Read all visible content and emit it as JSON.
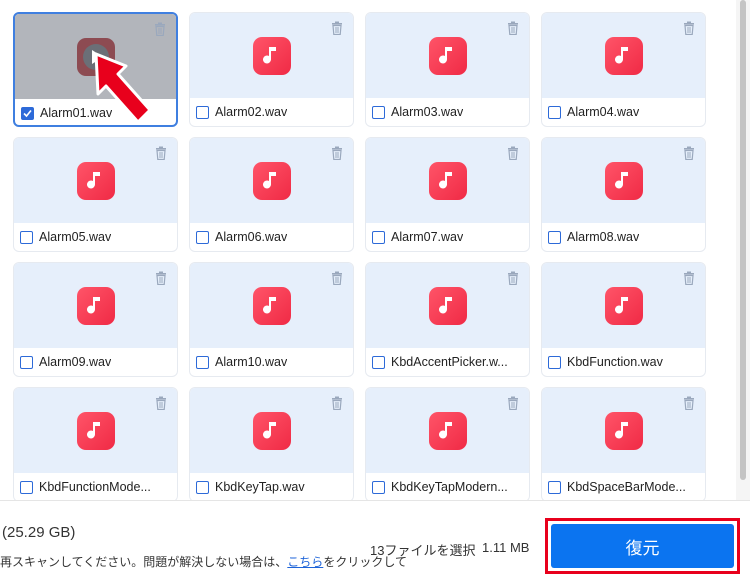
{
  "files": [
    {
      "name": "Alarm01.wav",
      "checked": true,
      "selected": true
    },
    {
      "name": "Alarm02.wav",
      "checked": false
    },
    {
      "name": "Alarm03.wav",
      "checked": false
    },
    {
      "name": "Alarm04.wav",
      "checked": false
    },
    {
      "name": "Alarm05.wav",
      "checked": false
    },
    {
      "name": "Alarm06.wav",
      "checked": false
    },
    {
      "name": "Alarm07.wav",
      "checked": false
    },
    {
      "name": "Alarm08.wav",
      "checked": false
    },
    {
      "name": "Alarm09.wav",
      "checked": false
    },
    {
      "name": "Alarm10.wav",
      "checked": false
    },
    {
      "name": "KbdAccentPicker.w...",
      "checked": false
    },
    {
      "name": "KbdFunction.wav",
      "checked": false
    },
    {
      "name": "KbdFunctionMode...",
      "checked": false
    },
    {
      "name": "KbdKeyTap.wav",
      "checked": false
    },
    {
      "name": "KbdKeyTapModern...",
      "checked": false
    },
    {
      "name": "KbdSpaceBarMode...",
      "checked": false
    }
  ],
  "footer": {
    "total_size": "(25.29 GB)",
    "hint_prefix": "再スキャンしてください。問題が解決しない場合は、",
    "hint_link": "こちら",
    "hint_suffix": "をクリックして",
    "selected_count": "13ファイルを選択",
    "selected_size": "1.11 MB",
    "restore_label": "復元"
  },
  "colors": {
    "accent": "#0b74f0",
    "highlight": "#e8001c",
    "music_icon": "#f02a45"
  }
}
